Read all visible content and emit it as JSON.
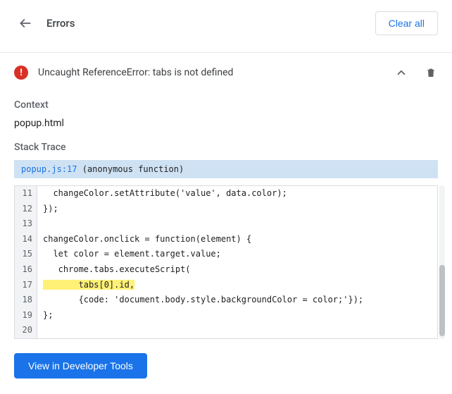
{
  "header": {
    "title": "Errors",
    "clear_all_label": "Clear all"
  },
  "error": {
    "title": "Uncaught ReferenceError: tabs is not defined",
    "context_heading": "Context",
    "context_value": "popup.html",
    "stack_heading": "Stack Trace",
    "stack_location": "popup.js:17",
    "stack_fn": "(anonymous function)",
    "highlighted_line_index": 6,
    "code_lines": [
      {
        "n": 11,
        "text": "  changeColor.setAttribute('value', data.color);"
      },
      {
        "n": 12,
        "text": "});"
      },
      {
        "n": 13,
        "text": ""
      },
      {
        "n": 14,
        "text": "changeColor.onclick = function(element) {"
      },
      {
        "n": 15,
        "text": "  let color = element.target.value;"
      },
      {
        "n": 16,
        "text": "   chrome.tabs.executeScript("
      },
      {
        "n": 17,
        "text": "       tabs[0].id,"
      },
      {
        "n": 18,
        "text": "       {code: 'document.body.style.backgroundColor = color;'});"
      },
      {
        "n": 19,
        "text": "};"
      },
      {
        "n": 20,
        "text": ""
      }
    ]
  },
  "actions": {
    "view_devtools_label": "View in Developer Tools"
  },
  "icons": {
    "error_glyph": "!"
  }
}
